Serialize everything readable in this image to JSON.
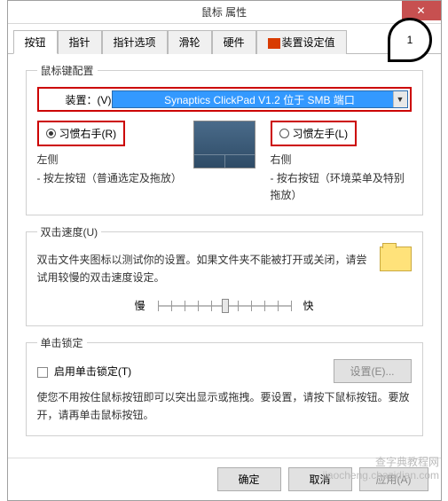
{
  "window": {
    "title": "鼠标 属性",
    "close_glyph": "✕"
  },
  "tabs": {
    "items": [
      {
        "label": "按钮"
      },
      {
        "label": "指针"
      },
      {
        "label": "指针选项"
      },
      {
        "label": "滑轮"
      },
      {
        "label": "硬件"
      },
      {
        "label": "装置设定值"
      }
    ],
    "active_index": 0
  },
  "button_config": {
    "legend": "鼠标键配置",
    "device_label": "装置：(V)",
    "device_value": "Synaptics ClickPad V1.2 位于 SMB 端口",
    "right_hand": {
      "label": "习惯右手(R)",
      "selected": true
    },
    "left_hand": {
      "label": "习惯左手(L)",
      "selected": false
    },
    "left_side": {
      "title": "左侧",
      "desc": "- 按左按钮（普通选定及拖放）"
    },
    "right_side": {
      "title": "右侧",
      "desc": "- 按右按钮（环境菜单及特别拖放）"
    }
  },
  "double_click": {
    "legend": "双击速度(U)",
    "desc": "双击文件夹图标以测试你的设置。如果文件夹不能被打开或关闭，请尝试用较慢的双击速度设定。",
    "slow": "慢",
    "fast": "快"
  },
  "click_lock": {
    "legend": "单击锁定",
    "enable_label": "启用单击锁定(T)",
    "settings_btn": "设置(E)...",
    "desc": "使您不用按住鼠标按钮即可以突出显示或拖拽。要设置，请按下鼠标按钮。要放开，请再单击鼠标按钮。"
  },
  "footer": {
    "ok": "确定",
    "cancel": "取消",
    "apply": "应用(A)"
  },
  "annotation": {
    "num": "1"
  },
  "watermark": {
    "line1": "查字典教程网",
    "line2": "jiaocheng.chazidian.com"
  }
}
